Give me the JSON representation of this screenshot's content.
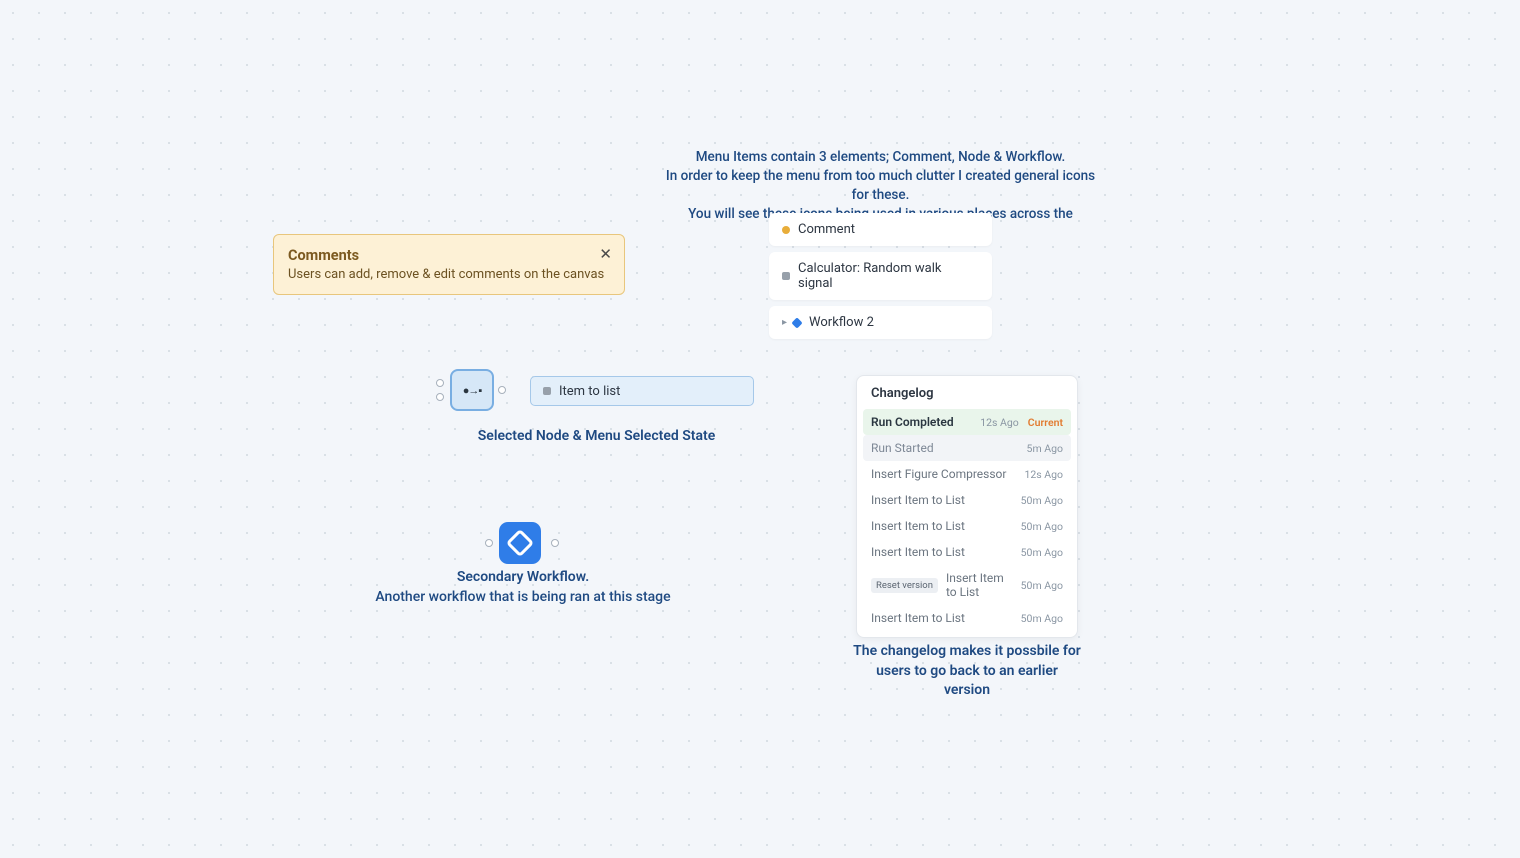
{
  "commentCard": {
    "title": "Comments",
    "desc": "Users can add, remove & edit comments on the canvas"
  },
  "topAnno": {
    "l1": "Menu Items contain 3 elements; Comment, Node & Workflow.",
    "l2": "In order to keep the menu from too much clutter I created general icons for these.",
    "l3": "You will see these icons being used in various places across the platform"
  },
  "menu": {
    "comment": "Comment",
    "calculator": "Calculator: Random walk signal",
    "workflow": "Workflow 2"
  },
  "selected": {
    "pill": "Item to list",
    "caption": "Selected Node & Menu Selected State"
  },
  "workflow": {
    "l1": "Secondary Workflow.",
    "l2": "Another workflow that is being ran at this stage"
  },
  "changelog": {
    "title": "Changelog",
    "caption": "The changelog makes it possbile for users to go back to an earlier version",
    "currentLabel": "Current",
    "resetLabel": "Reset version",
    "items": [
      {
        "name": "Run Completed",
        "time": "12s Ago",
        "kind": "green",
        "current": true
      },
      {
        "name": "Run Started",
        "time": "5m Ago",
        "kind": "grey"
      },
      {
        "name": "Insert Figure Compressor",
        "time": "12s Ago",
        "kind": "plain"
      },
      {
        "name": "Insert Item to List",
        "time": "50m Ago",
        "kind": "plain"
      },
      {
        "name": "Insert Item to List",
        "time": "50m Ago",
        "kind": "plain"
      },
      {
        "name": "Insert Item to List",
        "time": "50m Ago",
        "kind": "plain"
      },
      {
        "name": "Insert Item to List",
        "time": "50m Ago",
        "kind": "plain",
        "reset": true
      },
      {
        "name": "Insert Item to List",
        "time": "50m Ago",
        "kind": "plain"
      }
    ]
  }
}
